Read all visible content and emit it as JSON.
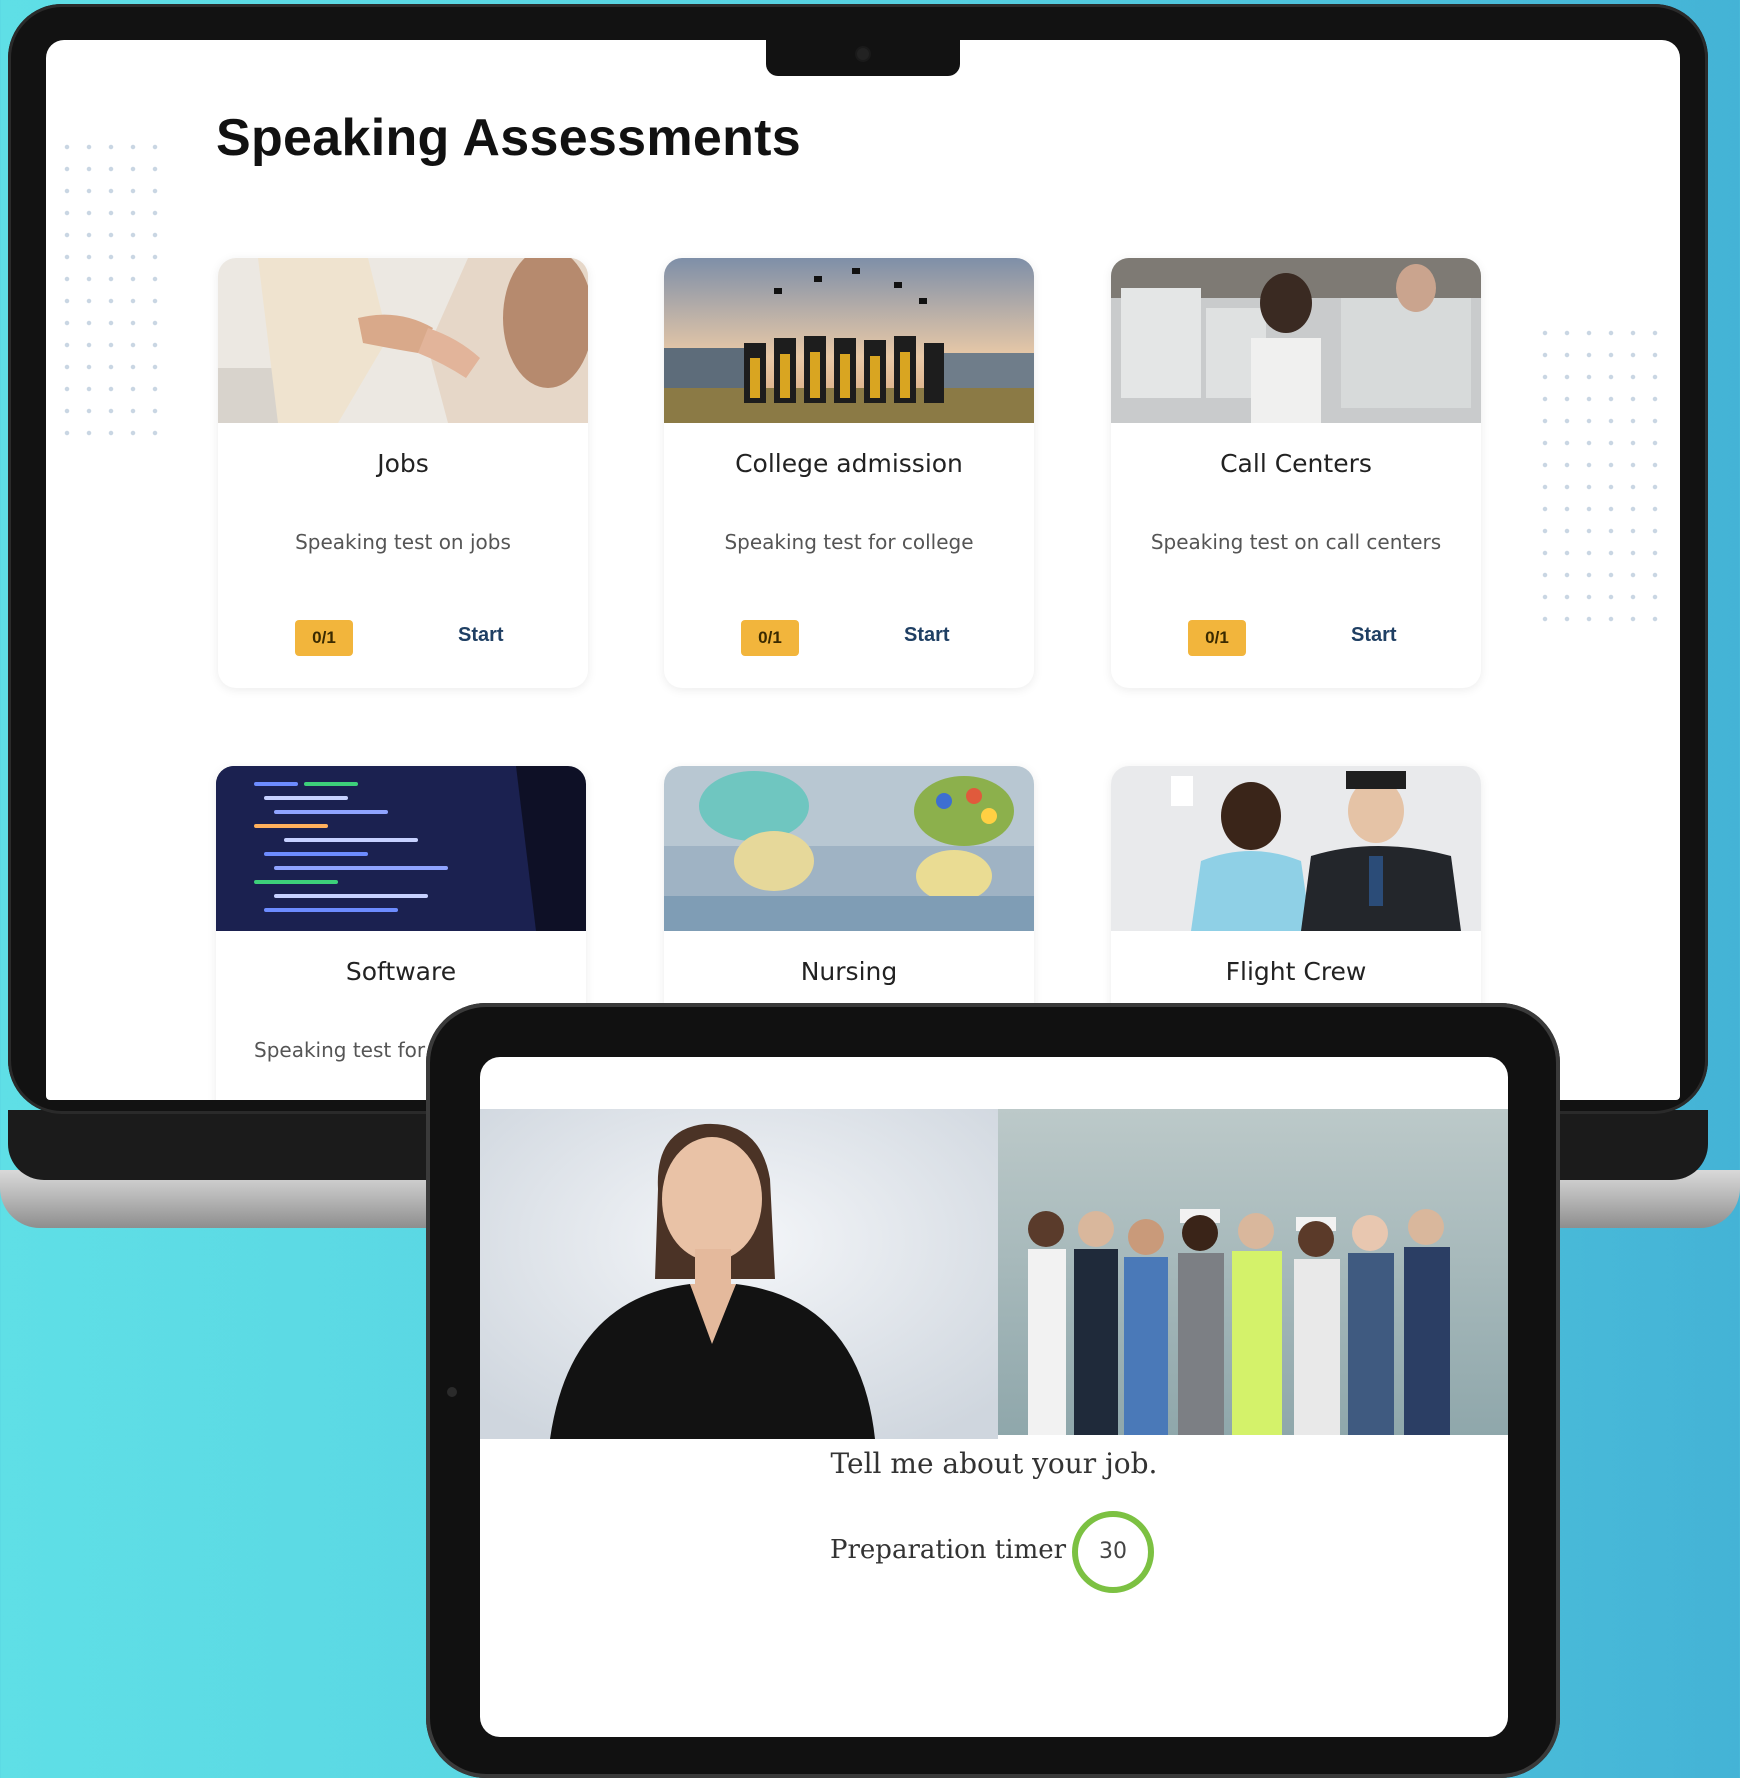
{
  "laptop": {
    "page_title": "Speaking Assessments",
    "cards": [
      {
        "title": "Jobs",
        "description": "Speaking test on jobs",
        "progress": "0/1",
        "action": "Start"
      },
      {
        "title": "College admission",
        "description": "Speaking test for college",
        "progress": "0/1",
        "action": "Start"
      },
      {
        "title": "Call Centers",
        "description": "Speaking test on call centers",
        "progress": "0/1",
        "action": "Start"
      },
      {
        "title": "Software",
        "description": "Speaking test for"
      },
      {
        "title": "Nursing"
      },
      {
        "title": "Flight Crew"
      }
    ]
  },
  "tablet": {
    "prompt": "Tell me about your job.",
    "timer_label": "Preparation timer",
    "timer_value": "30"
  },
  "colors": {
    "badge": "#f2b53c",
    "start_link": "#1f3f63",
    "timer_ring": "#7cc142"
  }
}
